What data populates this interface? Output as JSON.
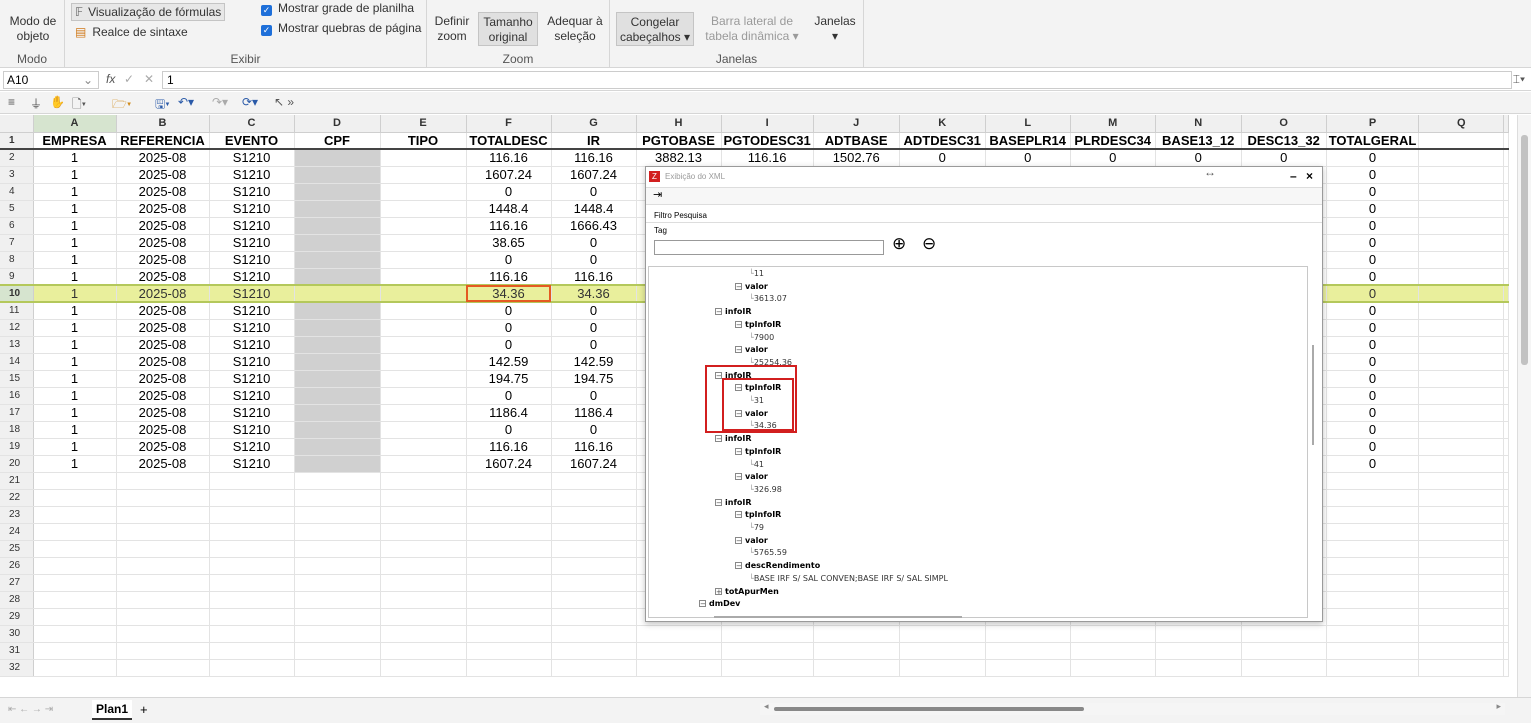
{
  "ribbon": {
    "modo": {
      "button": "Modo de objeto",
      "group": "Modo"
    },
    "exibir": {
      "formulas": "Visualização de fórmulas",
      "syntax": "Realce de sintaxe",
      "grid": "Mostrar grade de planilha",
      "pagebreaks": "Mostrar quebras de página",
      "group": "Exibir"
    },
    "zoom": {
      "define": "Definir zoom",
      "original": "Tamanho original",
      "fit": "Adequar à seleção",
      "group": "Zoom"
    },
    "janelas": {
      "freeze": "Congelar cabeçalhos",
      "pivot": "Barra lateral de tabela dinâmica",
      "windows": "Janelas",
      "group": "Janelas"
    }
  },
  "formula_bar": {
    "cell_ref": "A10",
    "fx": "fx",
    "value": "1"
  },
  "columns": [
    "A",
    "B",
    "C",
    "D",
    "E",
    "F",
    "G",
    "H",
    "I",
    "J",
    "K",
    "L",
    "M",
    "N",
    "O",
    "P",
    "Q"
  ],
  "headers": [
    "EMPRESA",
    "REFERENCIA",
    "EVENTO",
    "CPF",
    "TIPO",
    "TOTALDESC",
    "IR",
    "PGTOBASE",
    "PGTODESC31",
    "ADTBASE",
    "ADTDESC31",
    "BASEPLR14",
    "PLRDESC34",
    "BASE13_12",
    "DESC13_32",
    "TOTALGERAL",
    ""
  ],
  "rows": [
    [
      "1",
      "2025-08",
      "S1210",
      "",
      "",
      "116.16",
      "116.16",
      "3882.13",
      "116.16",
      "1502.76",
      "0",
      "0",
      "0",
      "0",
      "0",
      "0",
      ""
    ],
    [
      "1",
      "2025-08",
      "S1210",
      "",
      "",
      "1607.24",
      "1607.24",
      "",
      "",
      "",
      "",
      "",
      "",
      "",
      "",
      "0",
      ""
    ],
    [
      "1",
      "2025-08",
      "S1210",
      "",
      "",
      "0",
      "0",
      "",
      "",
      "",
      "",
      "",
      "",
      "",
      "",
      "0",
      ""
    ],
    [
      "1",
      "2025-08",
      "S1210",
      "",
      "",
      "1448.4",
      "1448.4",
      "",
      "",
      "",
      "",
      "",
      "",
      "",
      "",
      "0",
      ""
    ],
    [
      "1",
      "2025-08",
      "S1210",
      "",
      "",
      "116.16",
      "1666.43",
      "",
      "",
      "",
      "",
      "",
      "",
      "",
      "",
      "0",
      ""
    ],
    [
      "1",
      "2025-08",
      "S1210",
      "",
      "",
      "38.65",
      "0",
      "",
      "",
      "",
      "",
      "",
      "",
      "",
      "",
      "0",
      ""
    ],
    [
      "1",
      "2025-08",
      "S1210",
      "",
      "",
      "0",
      "0",
      "",
      "",
      "",
      "",
      "",
      "",
      "",
      "",
      "0",
      ""
    ],
    [
      "1",
      "2025-08",
      "S1210",
      "",
      "",
      "116.16",
      "116.16",
      "",
      "",
      "",
      "",
      "",
      "",
      "",
      "",
      "0",
      ""
    ],
    [
      "1",
      "2025-08",
      "S1210",
      "",
      "",
      "34.36",
      "34.36",
      "",
      "",
      "",
      "",
      "",
      "",
      "",
      "",
      "0",
      ""
    ],
    [
      "1",
      "2025-08",
      "S1210",
      "",
      "",
      "0",
      "0",
      "",
      "",
      "",
      "",
      "",
      "",
      "",
      "",
      "0",
      ""
    ],
    [
      "1",
      "2025-08",
      "S1210",
      "",
      "",
      "0",
      "0",
      "",
      "",
      "",
      "",
      "",
      "",
      "",
      "",
      "0",
      ""
    ],
    [
      "1",
      "2025-08",
      "S1210",
      "",
      "",
      "0",
      "0",
      "",
      "",
      "",
      "",
      "",
      "",
      "",
      "",
      "0",
      ""
    ],
    [
      "1",
      "2025-08",
      "S1210",
      "",
      "",
      "142.59",
      "142.59",
      "",
      "",
      "",
      "",
      "",
      "",
      "",
      "",
      "0",
      ""
    ],
    [
      "1",
      "2025-08",
      "S1210",
      "",
      "",
      "194.75",
      "194.75",
      "",
      "",
      "",
      "",
      "",
      "",
      "",
      "",
      "0",
      ""
    ],
    [
      "1",
      "2025-08",
      "S1210",
      "",
      "",
      "0",
      "0",
      "",
      "",
      "",
      "",
      "",
      "",
      "",
      "",
      "0",
      ""
    ],
    [
      "1",
      "2025-08",
      "S1210",
      "",
      "",
      "1186.4",
      "1186.4",
      "",
      "",
      "",
      "",
      "",
      "",
      "",
      "",
      "0",
      ""
    ],
    [
      "1",
      "2025-08",
      "S1210",
      "",
      "",
      "0",
      "0",
      "",
      "",
      "",
      "",
      "",
      "",
      "",
      "",
      "0",
      ""
    ],
    [
      "1",
      "2025-08",
      "S1210",
      "",
      "",
      "116.16",
      "116.16",
      "",
      "",
      "",
      "",
      "",
      "",
      "",
      "",
      "0",
      ""
    ],
    [
      "1",
      "2025-08",
      "S1210",
      "",
      "",
      "1607.24",
      "1607.24",
      "",
      "",
      "",
      "",
      "",
      "",
      "",
      "",
      "0",
      ""
    ]
  ],
  "total_rows": 32,
  "selected_row": 10,
  "xml_dialog": {
    "title": "Exibição do XML",
    "filter_label": "Filtro Pesquisa",
    "tag_label": "Tag",
    "tag_value": "",
    "tree": [
      {
        "depth": 3,
        "kind": "leaf",
        "text": "11"
      },
      {
        "depth": 2,
        "kind": "node",
        "text": "valor"
      },
      {
        "depth": 3,
        "kind": "leaf",
        "text": "3613.07"
      },
      {
        "depth": 1,
        "kind": "node",
        "text": "infoIR"
      },
      {
        "depth": 2,
        "kind": "node",
        "text": "tpInfoIR"
      },
      {
        "depth": 3,
        "kind": "leaf",
        "text": "7900"
      },
      {
        "depth": 2,
        "kind": "node",
        "text": "valor"
      },
      {
        "depth": 3,
        "kind": "leaf",
        "text": "25254.36"
      },
      {
        "depth": 1,
        "kind": "node",
        "text": "infoIR"
      },
      {
        "depth": 2,
        "kind": "node",
        "text": "tpInfoIR"
      },
      {
        "depth": 3,
        "kind": "leaf",
        "text": "31"
      },
      {
        "depth": 2,
        "kind": "node",
        "text": "valor"
      },
      {
        "depth": 3,
        "kind": "leaf",
        "text": "34.36"
      },
      {
        "depth": 1,
        "kind": "node",
        "text": "infoIR"
      },
      {
        "depth": 2,
        "kind": "node",
        "text": "tpInfoIR"
      },
      {
        "depth": 3,
        "kind": "leaf",
        "text": "41"
      },
      {
        "depth": 2,
        "kind": "node",
        "text": "valor"
      },
      {
        "depth": 3,
        "kind": "leaf",
        "text": "326.98"
      },
      {
        "depth": 1,
        "kind": "node",
        "text": "infoIR"
      },
      {
        "depth": 2,
        "kind": "node",
        "text": "tpInfoIR"
      },
      {
        "depth": 3,
        "kind": "leaf",
        "text": "79"
      },
      {
        "depth": 2,
        "kind": "node",
        "text": "valor"
      },
      {
        "depth": 3,
        "kind": "leaf",
        "text": "5765.59"
      },
      {
        "depth": 2,
        "kind": "node",
        "text": "descRendimento"
      },
      {
        "depth": 3,
        "kind": "leaf",
        "text": "BASE IRF S/ SAL CONVEN;BASE IRF S/ SAL SIMPL"
      },
      {
        "depth": 1,
        "kind": "collapsed",
        "text": "totApurMen"
      },
      {
        "depth": 0,
        "kind": "node",
        "text": "dmDev"
      }
    ]
  },
  "sheet_tabs": {
    "active": "Plan1",
    "add": "+"
  }
}
